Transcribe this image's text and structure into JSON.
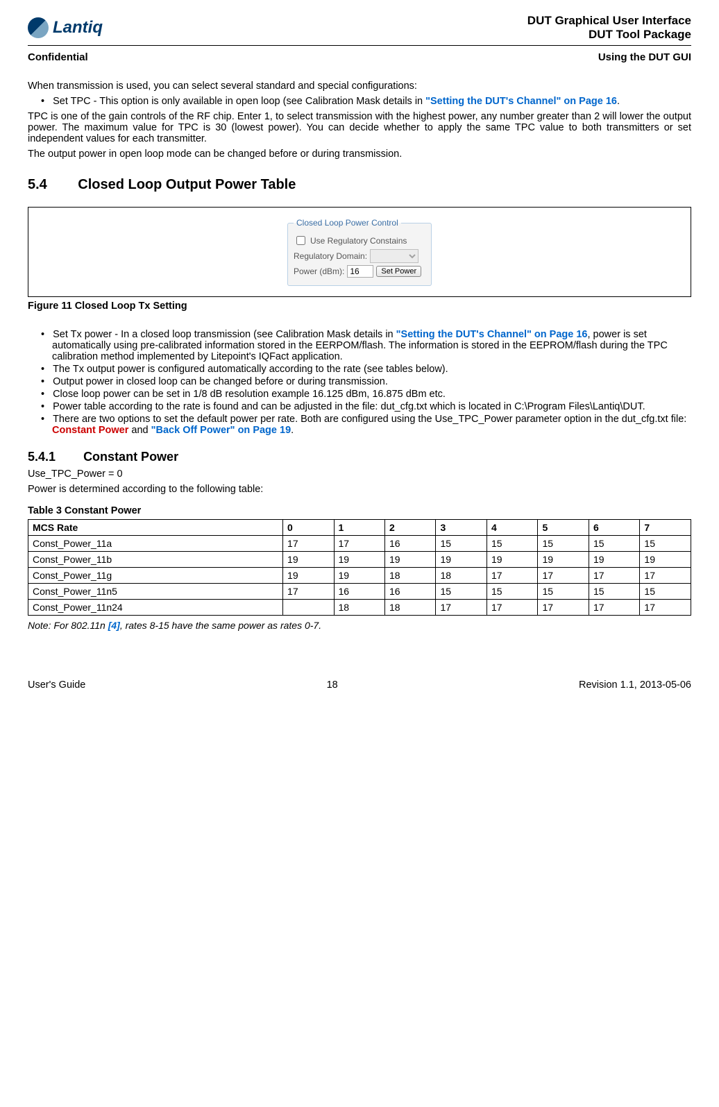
{
  "header": {
    "logo_text": "Lantiq",
    "doc_title1": "DUT Graphical User Interface",
    "doc_title2": "DUT Tool Package",
    "left_sub": "Confidential",
    "right_sub": "Using the DUT GUI"
  },
  "intro": {
    "p1": "When transmission is used, you can select several standard and special configurations:",
    "b1a": "Set TPC - This option is only available in open loop (see Calibration Mask details in ",
    "b1link": "\"Setting the DUT's Channel\" on Page 16",
    "b1b": ".",
    "p2": "TPC is one of the gain controls of the RF chip. Enter 1, to select transmission with the highest power, any number greater than 2 will lower the output power. The maximum value for TPC is 30 (lowest power). You can decide whether to apply the same TPC value to both transmitters or set independent values for each transmitter.",
    "p3": "The output power in open loop mode can be changed before or during transmission."
  },
  "sec54": {
    "num": "5.4",
    "title": "Closed Loop Output Power Table"
  },
  "panel": {
    "legend": "Closed Loop Power Control",
    "cb_label": "Use Regulatory Constains",
    "rd_label": "Regulatory Domain:",
    "pw_label": "Power (dBm):",
    "pw_value": "16",
    "btn": "Set Power"
  },
  "figcap": "Figure 11     Closed Loop Tx Setting",
  "bullets2": {
    "b1a": "Set Tx power - In a closed loop transmission (see Calibration Mask details in ",
    "b1link": "\"Setting the DUT's Channel\" on Page 16",
    "b1b": ", power is set automatically using pre-calibrated information stored in the EERPOM/flash. The information is stored in the EEPROM/flash during the TPC calibration method implemented by Litepoint's IQFact application.",
    "b2": "The Tx output power is configured automatically according to the rate (see tables below).",
    "b3": "Output power in closed loop can be changed before or during transmission.",
    "b4": "Close loop power can be set in 1/8 dB resolution example 16.125 dBm, 16.875 dBm etc.",
    "b5": "Power table according to the rate is found and can be adjusted in the file: dut_cfg.txt which is located in C:\\Program Files\\Lantiq\\DUT.",
    "b6a": "There are two options to set the default power per rate. Both are configured using the Use_TPC_Power parameter option in the dut_cfg.txt file: ",
    "b6link1": "Constant Power",
    "b6mid": " and ",
    "b6link2": "\"Back Off Power\" on Page 19",
    "b6b": "."
  },
  "sec541": {
    "num": "5.4.1",
    "title": "Constant Power",
    "l1": "Use_TPC_Power = 0",
    "l2": "Power is determined according to the following table:"
  },
  "table": {
    "title": "Table 3         Constant Power",
    "headers": [
      "MCS Rate",
      "0",
      "1",
      "2",
      "3",
      "4",
      "5",
      "6",
      "7"
    ],
    "rows": [
      [
        "Const_Power_11a",
        "17",
        "17",
        "16",
        "15",
        "15",
        "15",
        "15",
        "15"
      ],
      [
        "Const_Power_11b",
        "19",
        "19",
        "19",
        "19",
        "19",
        "19",
        "19",
        "19"
      ],
      [
        "Const_Power_11g",
        "19",
        "19",
        "18",
        "18",
        "17",
        "17",
        "17",
        "17"
      ],
      [
        "Const_Power_11n5",
        "17",
        "16",
        "16",
        "15",
        "15",
        "15",
        "15",
        "15"
      ],
      [
        "Const_Power_11n24",
        "",
        "18",
        "18",
        "17",
        "17",
        "17",
        "17",
        "17"
      ]
    ]
  },
  "note": {
    "pre": "Note: For 802.11n ",
    "ref": "[4]",
    "post": ", rates 8-15 have the same power as rates 0-7."
  },
  "footer": {
    "left": "User's Guide",
    "mid": "18",
    "right": "Revision 1.1, 2013-05-06"
  },
  "chart_data": {
    "type": "table",
    "title": "Table 3 Constant Power",
    "columns": [
      "MCS Rate",
      "0",
      "1",
      "2",
      "3",
      "4",
      "5",
      "6",
      "7"
    ],
    "rows": [
      {
        "label": "Const_Power_11a",
        "values": [
          17,
          17,
          16,
          15,
          15,
          15,
          15,
          15
        ]
      },
      {
        "label": "Const_Power_11b",
        "values": [
          19,
          19,
          19,
          19,
          19,
          19,
          19,
          19
        ]
      },
      {
        "label": "Const_Power_11g",
        "values": [
          19,
          19,
          18,
          18,
          17,
          17,
          17,
          17
        ]
      },
      {
        "label": "Const_Power_11n5",
        "values": [
          17,
          16,
          16,
          15,
          15,
          15,
          15,
          15
        ]
      },
      {
        "label": "Const_Power_11n24",
        "values": [
          null,
          18,
          18,
          17,
          17,
          17,
          17,
          17
        ]
      }
    ]
  }
}
